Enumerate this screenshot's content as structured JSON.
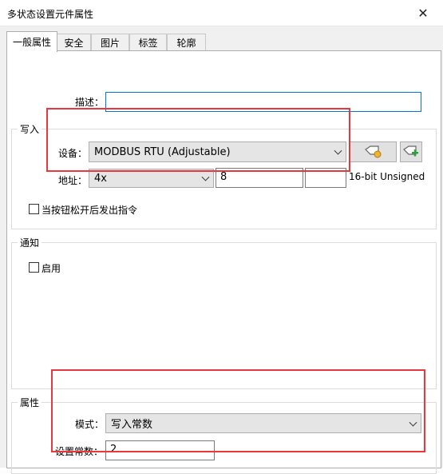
{
  "window": {
    "title": "多状态设置元件属性",
    "close_glyph": "✕"
  },
  "tabs": [
    {
      "label": "一般属性",
      "active": true
    },
    {
      "label": "安全"
    },
    {
      "label": "图片"
    },
    {
      "label": "标签"
    },
    {
      "label": "轮廓"
    }
  ],
  "description": {
    "label": "描述：",
    "value": ""
  },
  "write": {
    "group_title": "写入",
    "device_label": "设备：",
    "device_value": "MODBUS RTU (Adjustable)",
    "address_label": "地址：",
    "address_type": "4x",
    "address_value": "8",
    "address_extra": "",
    "data_format": "16-bit Unsigned",
    "checkbox_label": "当按钮松开后发出指令",
    "checkbox_checked": false
  },
  "notify": {
    "group_title": "通知",
    "enable_label": "启用",
    "enable_checked": false
  },
  "attributes": {
    "group_title": "属性",
    "mode_label": "模式：",
    "mode_value": "写入常数",
    "constant_label": "设置常数：",
    "constant_value": "2"
  },
  "colors": {
    "highlight": "#e8383d",
    "focus_border": "#0078d7"
  },
  "icons": {
    "tag_settings": "tag-gear-icon",
    "tag_add": "tag-add-icon",
    "close": "close-icon"
  }
}
